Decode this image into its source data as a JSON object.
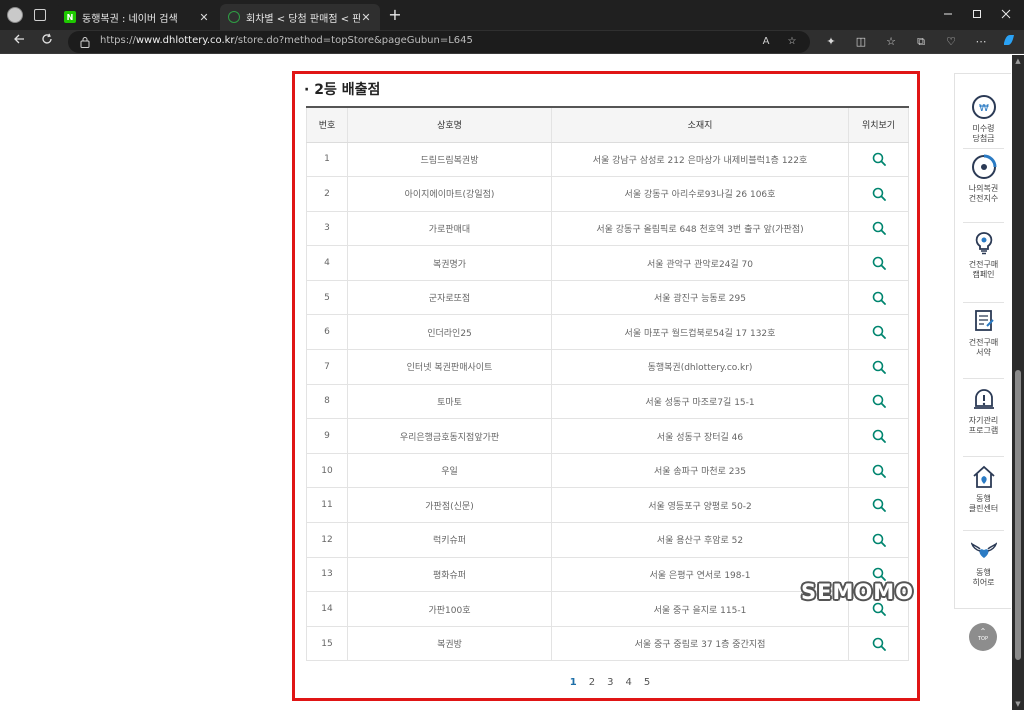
{
  "browser": {
    "tabs": [
      {
        "favicon": "N",
        "title": "동행복권 : 네이버 검색"
      },
      {
        "favicon": "",
        "title": "회차별 < 당첨 판매점 < 판매점 | "
      }
    ],
    "url_prefix": "https://",
    "url_host": "www.dhlottery.co.kr",
    "url_path": "/store.do?method=topStore&pageGubun=L645",
    "close_glyph": "✕",
    "new_tab_glyph": "+"
  },
  "section": {
    "bullet": "·",
    "title": "2등 배출점"
  },
  "table": {
    "headers": [
      "번호",
      "상호명",
      "소재지",
      "위치보기"
    ],
    "rows": [
      {
        "no": "1",
        "name": "드림드림복권방",
        "address": "서울 강남구 삼성로 212 은마상가 내제비블럭1층 122호"
      },
      {
        "no": "2",
        "name": "아이지에이마트(강일점)",
        "address": "서울 강동구 아리수로93나길 26 106호"
      },
      {
        "no": "3",
        "name": "가로판매대",
        "address": "서울 강동구 올림픽로 648 천호역 3번 출구 앞(가판점)"
      },
      {
        "no": "4",
        "name": "복권명가",
        "address": "서울 관악구 관악로24길 70"
      },
      {
        "no": "5",
        "name": "군자로또점",
        "address": "서울 광진구 능동로 295"
      },
      {
        "no": "6",
        "name": "인더라인25",
        "address": "서울 마포구 월드컵북로54길 17 132호"
      },
      {
        "no": "7",
        "name": "인터넷 복권판매사이트",
        "address": "동행복권(dhlottery.co.kr)"
      },
      {
        "no": "8",
        "name": "토마토",
        "address": "서울 성동구 마조로7길 15-1"
      },
      {
        "no": "9",
        "name": "우리은행금호동지점앞가판",
        "address": "서울 성동구 장터길 46"
      },
      {
        "no": "10",
        "name": "우일",
        "address": "서울 송파구 마천로 235"
      },
      {
        "no": "11",
        "name": "가판점(신문)",
        "address": "서울 영등포구 양평로 50-2"
      },
      {
        "no": "12",
        "name": "럭키슈퍼",
        "address": "서울 용산구 후암로 52"
      },
      {
        "no": "13",
        "name": "평화슈퍼",
        "address": "서울 은평구 연서로 198-1"
      },
      {
        "no": "14",
        "name": "가판100호",
        "address": "서울 중구 을지로 115-1"
      },
      {
        "no": "15",
        "name": "복권방",
        "address": "서울 중구 중림로 37 1층 중간지점"
      }
    ]
  },
  "pagination": {
    "pages": [
      "1",
      "2",
      "3",
      "4",
      "5"
    ],
    "current": "1"
  },
  "quick_menu": [
    {
      "icon": "won-coin-icon",
      "label": "미수령\n당첨금"
    },
    {
      "icon": "gauge-icon",
      "label": "나의복권\n건전지수"
    },
    {
      "icon": "lightbulb-icon",
      "label": "건전구매\n캠페인"
    },
    {
      "icon": "pledge-document-icon",
      "label": "건전구매\n서약"
    },
    {
      "icon": "alert-icon",
      "label": "자기관리\n프로그램"
    },
    {
      "icon": "clean-house-icon",
      "label": "동행\n클린센터"
    },
    {
      "icon": "heart-wings-icon",
      "label": "동행\n히어로"
    }
  ],
  "top_button": {
    "arrow": "⌃",
    "label": "TOP"
  },
  "watermark": "SEMOMO",
  "colors": {
    "accent_blue": "#1e6fa8",
    "search_teal": "#00856f",
    "highlight_red": "#e01515"
  }
}
